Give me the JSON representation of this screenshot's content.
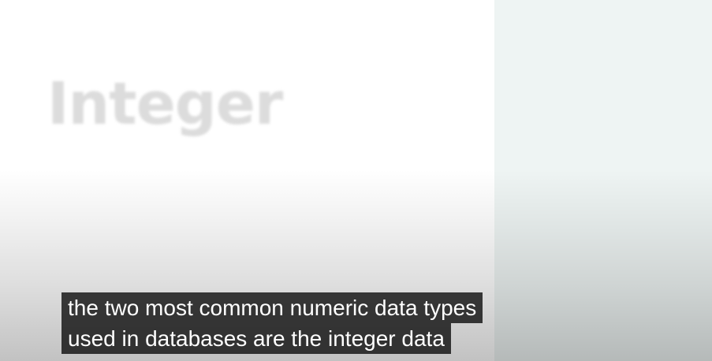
{
  "slide": {
    "title": "Integer"
  },
  "captions": {
    "lines": [
      "the two most common numeric data types",
      "used in databases are the integer data"
    ]
  },
  "colors": {
    "right_panel": "#eef4f3",
    "caption_background": "#080808",
    "caption_text": "#ffffff",
    "title_text": "#dcdcdc"
  }
}
